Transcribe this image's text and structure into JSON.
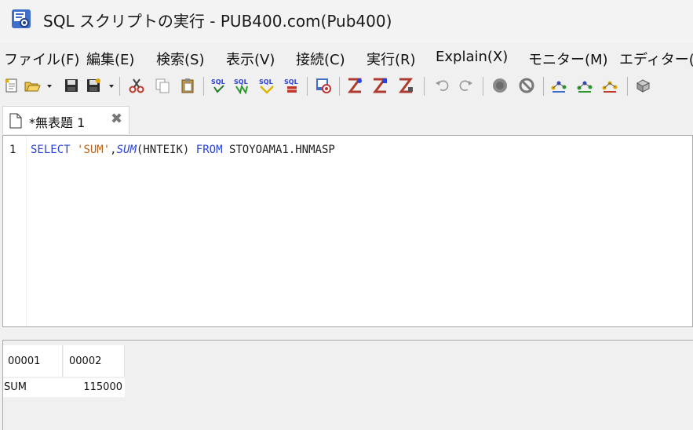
{
  "window": {
    "title": "SQL スクリプトの実行 - PUB400.com(Pub400)",
    "icon": "sql-script-app-icon"
  },
  "menu": {
    "items": [
      "ファイル(F)",
      "編集(E)",
      "検索(S)",
      "表示(V)",
      "接続(C)",
      "実行(R)",
      "Explain(X)",
      "モニター(M)",
      "エディター(E)"
    ]
  },
  "toolbar": {
    "icons": [
      "new-script-icon",
      "open-icon",
      "save-icon",
      "save-as-icon",
      "cut-icon",
      "copy-icon",
      "paste-icon",
      "run-sql-icon",
      "run-all-icon",
      "run-from-icon",
      "run-selected-icon",
      "connection-icon",
      "explain-icon",
      "explain-visual-icon",
      "explain-stop-icon",
      "undo-icon",
      "redo-icon",
      "stop-icon",
      "cancel-icon",
      "monitor-icon",
      "monitor-start-icon",
      "monitor-stop-icon",
      "print-icon"
    ]
  },
  "tab": {
    "label": "*無表題 1",
    "close": "✖"
  },
  "editor": {
    "line_number": "1",
    "tokens": {
      "select": "SELECT",
      "string": "'SUM'",
      "comma": ",",
      "func": "SUM",
      "args": "(HNTEIK)",
      "from": "FROM",
      "table": "STOYOAMA1.HNMASP"
    }
  },
  "results": {
    "columns": [
      "00001",
      "00002"
    ],
    "rows": [
      [
        "SUM",
        "115000"
      ]
    ]
  },
  "colors": {
    "keyword": "#2b44d8",
    "string": "#b5651d"
  }
}
